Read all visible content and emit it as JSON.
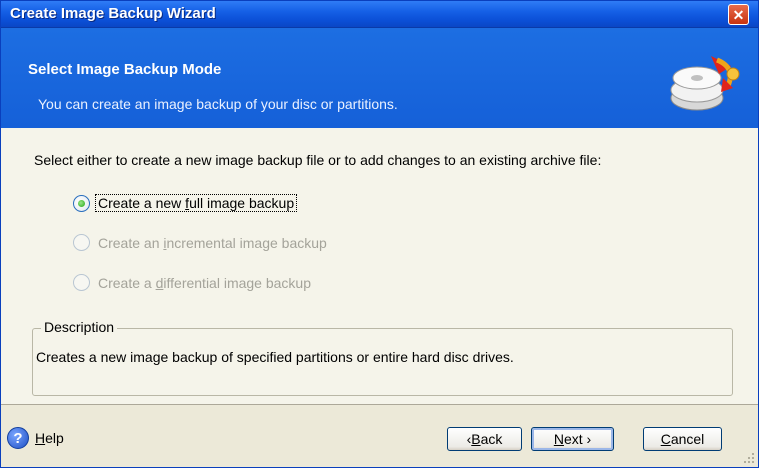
{
  "window": {
    "title": "Create Image Backup Wizard"
  },
  "header": {
    "title": "Select Image Backup Mode",
    "subtitle": "You can create an image backup of your disc or partitions."
  },
  "body": {
    "instruction": "Select either to create a new image backup file or to add changes to an existing archive file:",
    "options": [
      {
        "pre": "Create a new ",
        "accel": "f",
        "post": "ull image backup",
        "checked": true,
        "enabled": true
      },
      {
        "pre": "Create an ",
        "accel": "i",
        "post": "ncremental image backup",
        "checked": false,
        "enabled": false
      },
      {
        "pre": "Create a ",
        "accel": "d",
        "post": "ifferential image backup",
        "checked": false,
        "enabled": false
      }
    ],
    "description": {
      "legend": "Description",
      "text": "Creates a new image backup of specified partitions or entire hard disc drives."
    }
  },
  "footer": {
    "help": {
      "accel": "H",
      "rest": "elp"
    },
    "back": {
      "prefix": "‹ ",
      "accel": "B",
      "rest": "ack"
    },
    "next": {
      "accel": "N",
      "rest": "ext ›"
    },
    "cancel": {
      "accel": "C",
      "rest": "ancel"
    }
  },
  "colors": {
    "titlebar": "#0b4fd6",
    "header": "#1a66dc",
    "body": "#f5f4ea",
    "footer": "#ece9d8",
    "disabled_text": "#a4a39a",
    "radio_checked": "#22a613"
  },
  "icons": [
    "close-icon",
    "backup-disc-icon",
    "help-icon",
    "resize-grip-icon"
  ]
}
